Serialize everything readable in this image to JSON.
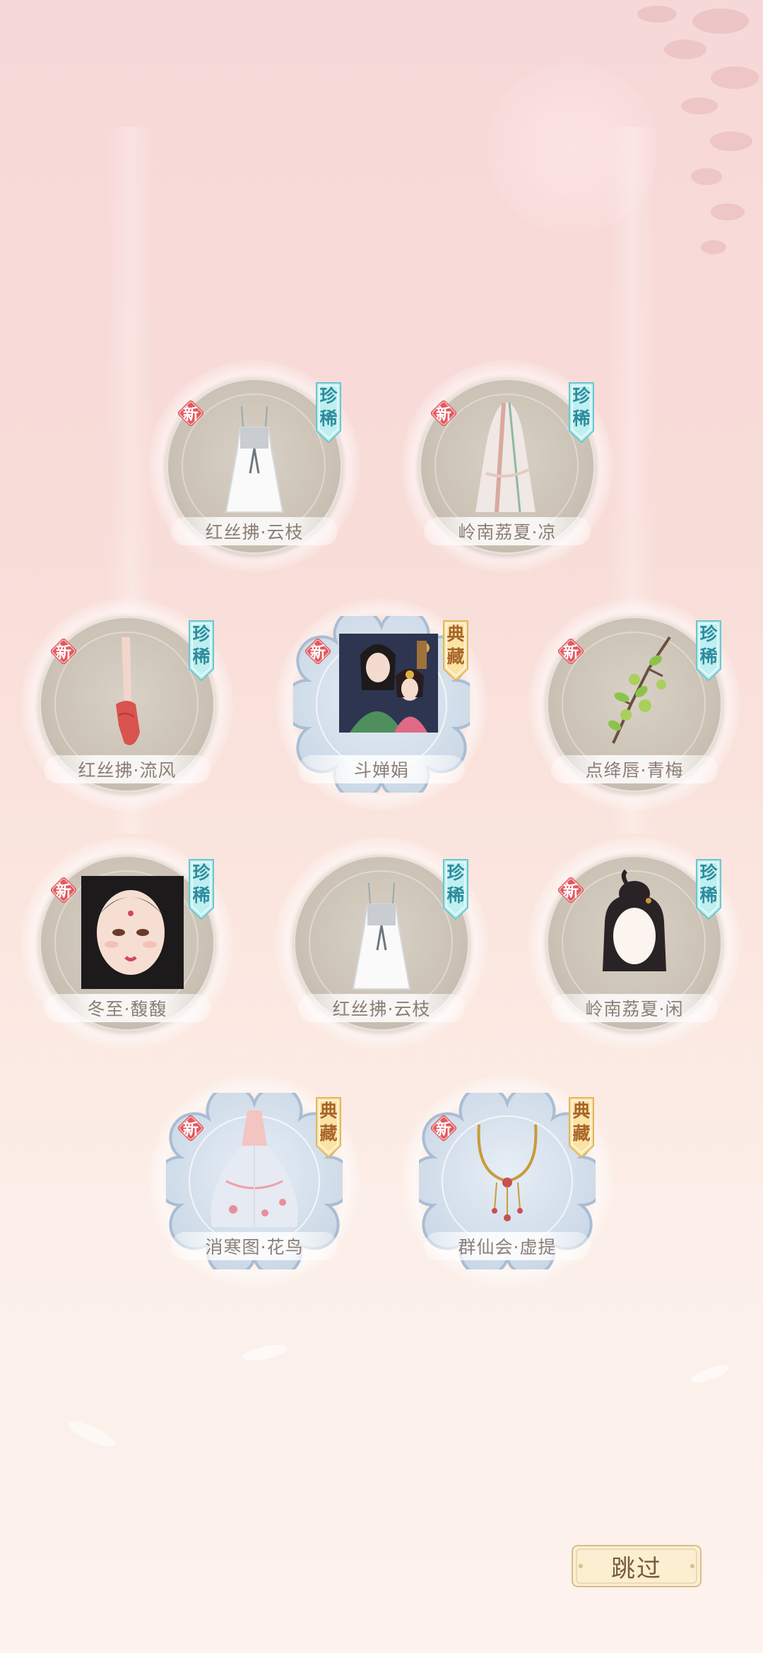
{
  "colors": {
    "background_top": "#f7d8d8",
    "background_bottom": "#fdf2ee",
    "new_badge": "#e2585d",
    "rare_tag": "#bfeff0",
    "classic_tag": "#fbe3a6",
    "label_text": "#8c7e76"
  },
  "items": [
    {
      "name": "红丝拂·云枝",
      "new_label": "新",
      "rarity": "珍稀",
      "rarity_type": "rare",
      "frame": "round",
      "icon": "white-dress-icon"
    },
    {
      "name": "岭南荔夏·凉",
      "new_label": "新",
      "rarity": "珍稀",
      "rarity_type": "rare",
      "frame": "round",
      "icon": "draped-robe-icon"
    },
    {
      "name": "红丝拂·流风",
      "new_label": "新",
      "rarity": "珍稀",
      "rarity_type": "rare",
      "frame": "round",
      "icon": "red-shoes-icon"
    },
    {
      "name": "斗婵娟",
      "new_label": "新",
      "rarity": "典藏",
      "rarity_type": "classic",
      "frame": "scallop",
      "icon": "couple-portrait-icon"
    },
    {
      "name": "点绛唇·青梅",
      "new_label": "新",
      "rarity": "珍稀",
      "rarity_type": "rare",
      "frame": "round",
      "icon": "plum-branch-icon"
    },
    {
      "name": "冬至·馥馥",
      "new_label": "新",
      "rarity": "珍稀",
      "rarity_type": "rare",
      "frame": "round",
      "icon": "face-makeup-icon"
    },
    {
      "name": "红丝拂·云枝",
      "new_label": "",
      "rarity": "珍稀",
      "rarity_type": "rare",
      "frame": "round",
      "icon": "white-dress-icon"
    },
    {
      "name": "岭南荔夏·闲",
      "new_label": "新",
      "rarity": "珍稀",
      "rarity_type": "rare",
      "frame": "round",
      "icon": "hairstyle-icon"
    },
    {
      "name": "消寒图·花鸟",
      "new_label": "新",
      "rarity": "典藏",
      "rarity_type": "classic",
      "frame": "scallop",
      "icon": "flowing-skirt-icon"
    },
    {
      "name": "群仙会·虚提",
      "new_label": "新",
      "rarity": "典藏",
      "rarity_type": "classic",
      "frame": "scallop",
      "icon": "necklace-icon"
    }
  ],
  "skip_button": {
    "label": "跳过"
  }
}
